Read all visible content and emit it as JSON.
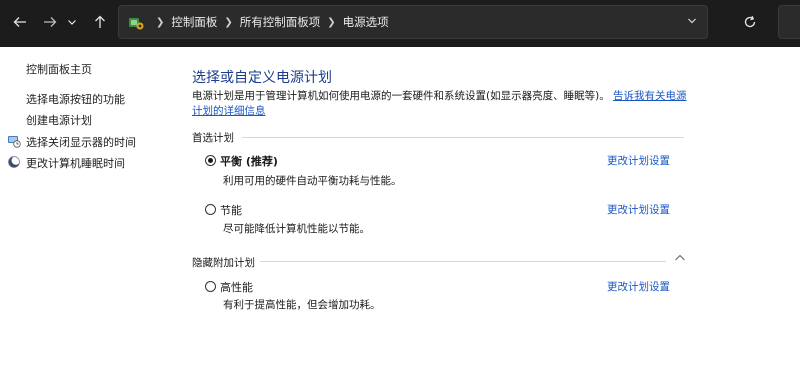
{
  "nav": {
    "back_icon": "arrow-left-icon",
    "forward_icon": "arrow-right-icon",
    "recent_icon": "chevron-down-icon",
    "up_icon": "arrow-up-icon",
    "refresh_icon": "refresh-icon"
  },
  "address": {
    "breadcrumbs": [
      "控制面板",
      "所有控制面板项",
      "电源选项"
    ]
  },
  "left_pane": {
    "home_label": "控制面板主页",
    "links": [
      "选择电源按钮的功能",
      "创建电源计划",
      "选择关闭显示器的时间",
      "更改计算机睡眠时间"
    ]
  },
  "main": {
    "title": "选择或自定义电源计划",
    "description": "电源计划是用于管理计算机如何使用电源的一套硬件和系统设置(如显示器亮度、睡眠等)。",
    "learn_more": "告诉我有关电源计划的详细信息",
    "preferred_section": "首选计划",
    "hidden_section": "隐藏附加计划",
    "change_label": "更改计划设置",
    "plans": [
      {
        "name": "平衡 (推荐)",
        "desc": "利用可用的硬件自动平衡功耗与性能。",
        "selected": true
      },
      {
        "name": "节能",
        "desc": "尽可能降低计算机性能以节能。",
        "selected": false
      },
      {
        "name": "高性能",
        "desc": "有利于提高性能，但会增加功耗。",
        "selected": false
      }
    ]
  },
  "colors": {
    "topbar": "#1c1c1c",
    "title": "#1b3c8c",
    "link": "#1a56c4"
  }
}
